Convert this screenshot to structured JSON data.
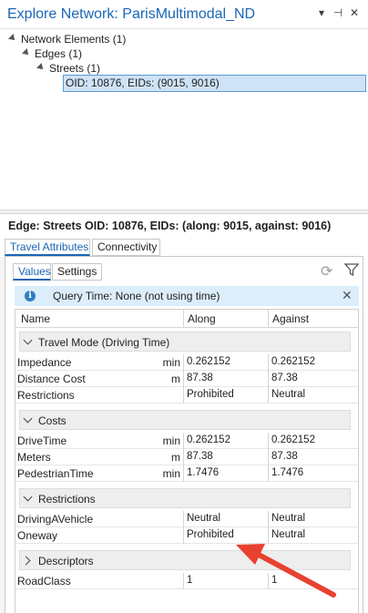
{
  "window": {
    "title": "Explore Network: ParisMultimodal_ND",
    "controls": {
      "menu": "▾",
      "pin": "⊣",
      "close": "✕"
    }
  },
  "tree": {
    "items": [
      {
        "label": "Network Elements (1)"
      },
      {
        "label": "Edges (1)"
      },
      {
        "label": "Streets (1)"
      }
    ],
    "selected": "OID: 10876, EIDs: (9015, 9016)"
  },
  "edge_header": "Edge: Streets OID: 10876, EIDs: (along: 9015, against: 9016)",
  "tabs": [
    "Travel Attributes",
    "Connectivity"
  ],
  "subtabs": [
    "Values",
    "Settings"
  ],
  "info": {
    "icon": "i",
    "text": "Query Time: None (not using time)"
  },
  "grid": {
    "columns": [
      "Name",
      "Along",
      "Against"
    ],
    "groups": [
      {
        "label": "Travel Mode (Driving Time)",
        "rows": [
          {
            "name": "Impedance",
            "unit": "min",
            "along": "0.262152",
            "against": "0.262152"
          },
          {
            "name": "Distance Cost",
            "unit": "m",
            "along": "87.38",
            "against": "87.38"
          },
          {
            "name": "Restrictions",
            "unit": "",
            "along": "Prohibited",
            "against": "Neutral"
          }
        ]
      },
      {
        "label": "Costs",
        "rows": [
          {
            "name": "DriveTime",
            "unit": "min",
            "along": "0.262152",
            "against": "0.262152"
          },
          {
            "name": "Meters",
            "unit": "m",
            "along": "87.38",
            "against": "87.38"
          },
          {
            "name": "PedestrianTime",
            "unit": "min",
            "along": "1.7476",
            "against": "1.7476"
          }
        ]
      },
      {
        "label": "Restrictions",
        "rows": [
          {
            "name": "DrivingAVehicle",
            "unit": "",
            "along": "Neutral",
            "against": "Neutral"
          },
          {
            "name": "Oneway",
            "unit": "",
            "along": "Prohibited",
            "against": "Neutral"
          }
        ]
      },
      {
        "label": "Descriptors",
        "rows": [
          {
            "name": "RoadClass",
            "unit": "",
            "along": "1",
            "against": "1"
          }
        ]
      }
    ]
  },
  "colors": {
    "accent": "#1a66b5",
    "selection": "#cfe3f7",
    "info_bg": "#dceefb",
    "annotation_arrow": "#e8412f"
  }
}
